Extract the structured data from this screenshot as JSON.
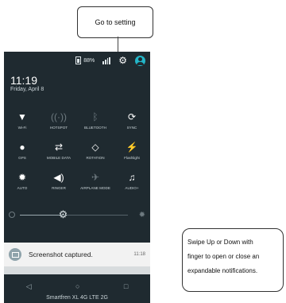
{
  "callouts": {
    "top": "Go to setting",
    "right_lines": [
      "Swipe Up or Down with",
      "finger to open or close an",
      "expandable notifications."
    ]
  },
  "status_bar": {
    "battery_percent": "88%",
    "icons": [
      "battery-icon",
      "signal-bars-icon",
      "gear-icon",
      "account-icon"
    ]
  },
  "header": {
    "time": "11:19",
    "date": "Friday, April 8"
  },
  "quick_settings": [
    {
      "label": "Wi-Fi",
      "icon": "wifi-icon",
      "glyph": "▼",
      "active": true
    },
    {
      "label": "HOTSPOT",
      "icon": "hotspot-icon",
      "glyph": "((·))",
      "active": false
    },
    {
      "label": "BLUETOOTH",
      "icon": "bluetooth-icon",
      "glyph": "ᛒ",
      "active": false
    },
    {
      "label": "SYNC",
      "icon": "sync-icon",
      "glyph": "⟳",
      "active": true
    },
    {
      "label": "GPS",
      "icon": "location-icon",
      "glyph": "●",
      "active": true
    },
    {
      "label": "MOBILE DATA",
      "icon": "mobile-data-icon",
      "glyph": "⇄",
      "active": true
    },
    {
      "label": "ROTATION",
      "icon": "rotation-icon",
      "glyph": "◇",
      "active": true
    },
    {
      "label": "Flashlight",
      "icon": "flashlight-icon",
      "glyph": "⚡",
      "active": false
    },
    {
      "label": "AUTO",
      "icon": "brightness-auto-icon",
      "glyph": "✹",
      "active": true
    },
    {
      "label": "RINGER",
      "icon": "ringer-icon",
      "glyph": "◀)",
      "active": true
    },
    {
      "label": "AIRPLANE MODE",
      "icon": "airplane-icon",
      "glyph": "✈",
      "active": false
    },
    {
      "label": "AUDIO+",
      "icon": "audio-plus-icon",
      "glyph": "♫",
      "active": true
    }
  ],
  "brightness": {
    "level": 0.4
  },
  "notification": {
    "text": "Screenshot captured.",
    "time": "11:18"
  },
  "navbar": {
    "icons": [
      "back-icon",
      "home-icon",
      "recents-icon"
    ]
  },
  "carrier": {
    "text": "Smartfren  XL 4G LTE 2G"
  }
}
